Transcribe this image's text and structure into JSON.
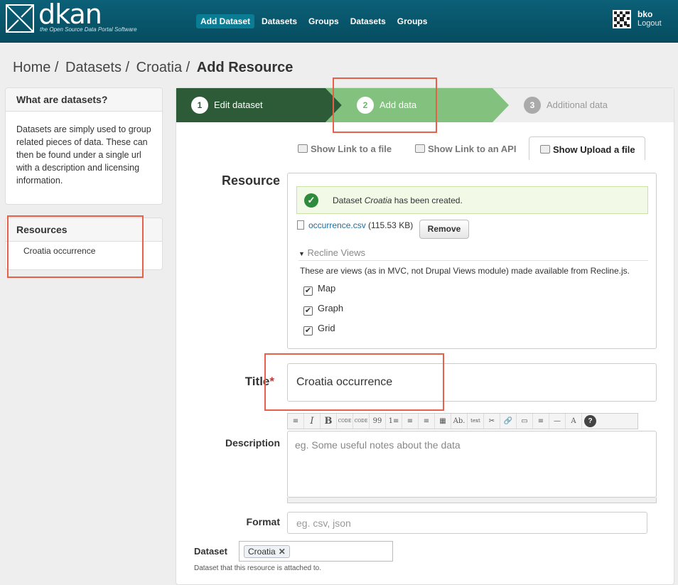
{
  "header": {
    "logo_text": "dkan",
    "logo_tagline": "the Open Source Data Portal Software",
    "nav": [
      "Add Dataset",
      "Datasets",
      "Groups",
      "Datasets",
      "Groups"
    ],
    "user": "bko",
    "logout": "Logout"
  },
  "breadcrumb": [
    "Home /",
    "Datasets /",
    "Croatia /",
    "Add Resource"
  ],
  "sidebar": {
    "info_title": "What are datasets?",
    "info_text": "Datasets are simply used to group related pieces of data. These can then be found under a single url with a description and licensing information.",
    "resources_title": "Resources",
    "resources_items": [
      "Croatia occurrence"
    ]
  },
  "stages": [
    {
      "num": "1",
      "label": "Edit dataset"
    },
    {
      "num": "2",
      "label": "Add data"
    },
    {
      "num": "3",
      "label": "Additional data"
    }
  ],
  "tabs": [
    "Show Link to a file",
    "Show Link to an API",
    "Show Upload a file"
  ],
  "form": {
    "resource_label": "Resource",
    "alert_prefix": "Dataset ",
    "alert_name": "Croatia",
    "alert_suffix": " has been created.",
    "file_name": "occurrence.csv",
    "file_size": "(115.53 KB)",
    "remove_label": "Remove",
    "recline_title": "Recline Views",
    "recline_desc": "These are views (as in MVC, not Drupal Views module) made available from Recline.js.",
    "views": [
      "Map",
      "Graph",
      "Grid"
    ],
    "title_label": "Title",
    "title_required": "*",
    "title_value": "Croatia occurrence",
    "description_label": "Description",
    "description_placeholder": "eg. Some useful notes about the data",
    "format_label": "Format",
    "format_placeholder": "eg. csv, json",
    "dataset_label": "Dataset",
    "dataset_value": "Croatia",
    "dataset_help": "Dataset that this resource is attached to."
  },
  "toolbar": [
    "≡",
    "I",
    "B",
    "CODE",
    "CODE",
    "99",
    "1≡",
    "≡",
    "≡",
    "▦",
    "Ab.",
    "text",
    "✂",
    "🔗",
    "▭",
    "≡",
    "—",
    "A",
    "?"
  ]
}
